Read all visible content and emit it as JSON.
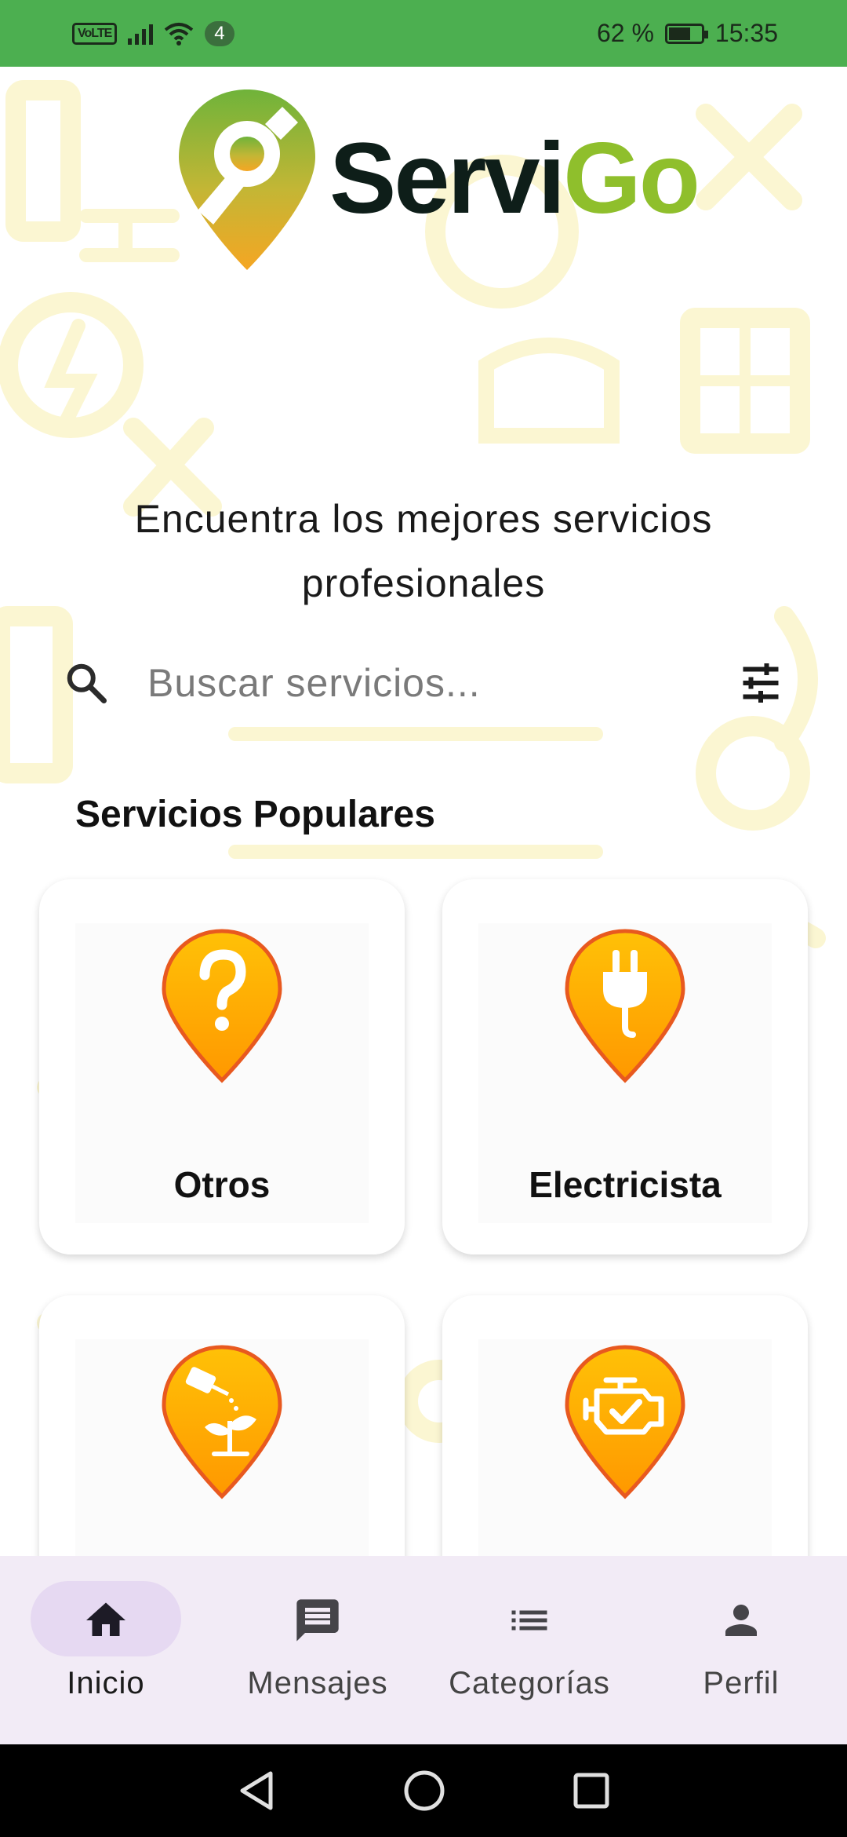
{
  "status_bar": {
    "network_badge": "VoLTE",
    "wifi_count": "4",
    "battery_percent": "62 %",
    "battery_level": 0.62,
    "time": "15:35"
  },
  "brand": {
    "name_part1": "Servi",
    "name_part2": "Go",
    "dark_color": "#0e1e19",
    "green_color": "#8fbf2c",
    "orange_color": "#f5a623"
  },
  "headline": "Encuentra los mejores servicios profesionales",
  "search": {
    "placeholder": "Buscar servicios..."
  },
  "popular": {
    "title": "Servicios Populares",
    "items": [
      {
        "label": "Otros",
        "icon": "question-icon"
      },
      {
        "label": "Electricista",
        "icon": "plug-icon"
      },
      {
        "label": "",
        "icon": "gardening-icon"
      },
      {
        "label": "",
        "icon": "engine-icon"
      }
    ]
  },
  "bottom_nav": {
    "items": [
      {
        "label": "Inicio",
        "icon": "home-icon",
        "active": true
      },
      {
        "label": "Mensajes",
        "icon": "message-icon"
      },
      {
        "label": "Categorías",
        "icon": "list-icon"
      },
      {
        "label": "Perfil",
        "icon": "person-icon"
      }
    ]
  },
  "colors": {
    "status_bar": "#4caf50",
    "nav_background": "#f2ebf6",
    "nav_active_pill": "#e6d9f2",
    "pin_orange": "#ffb300",
    "pin_outline": "#e8591f"
  }
}
